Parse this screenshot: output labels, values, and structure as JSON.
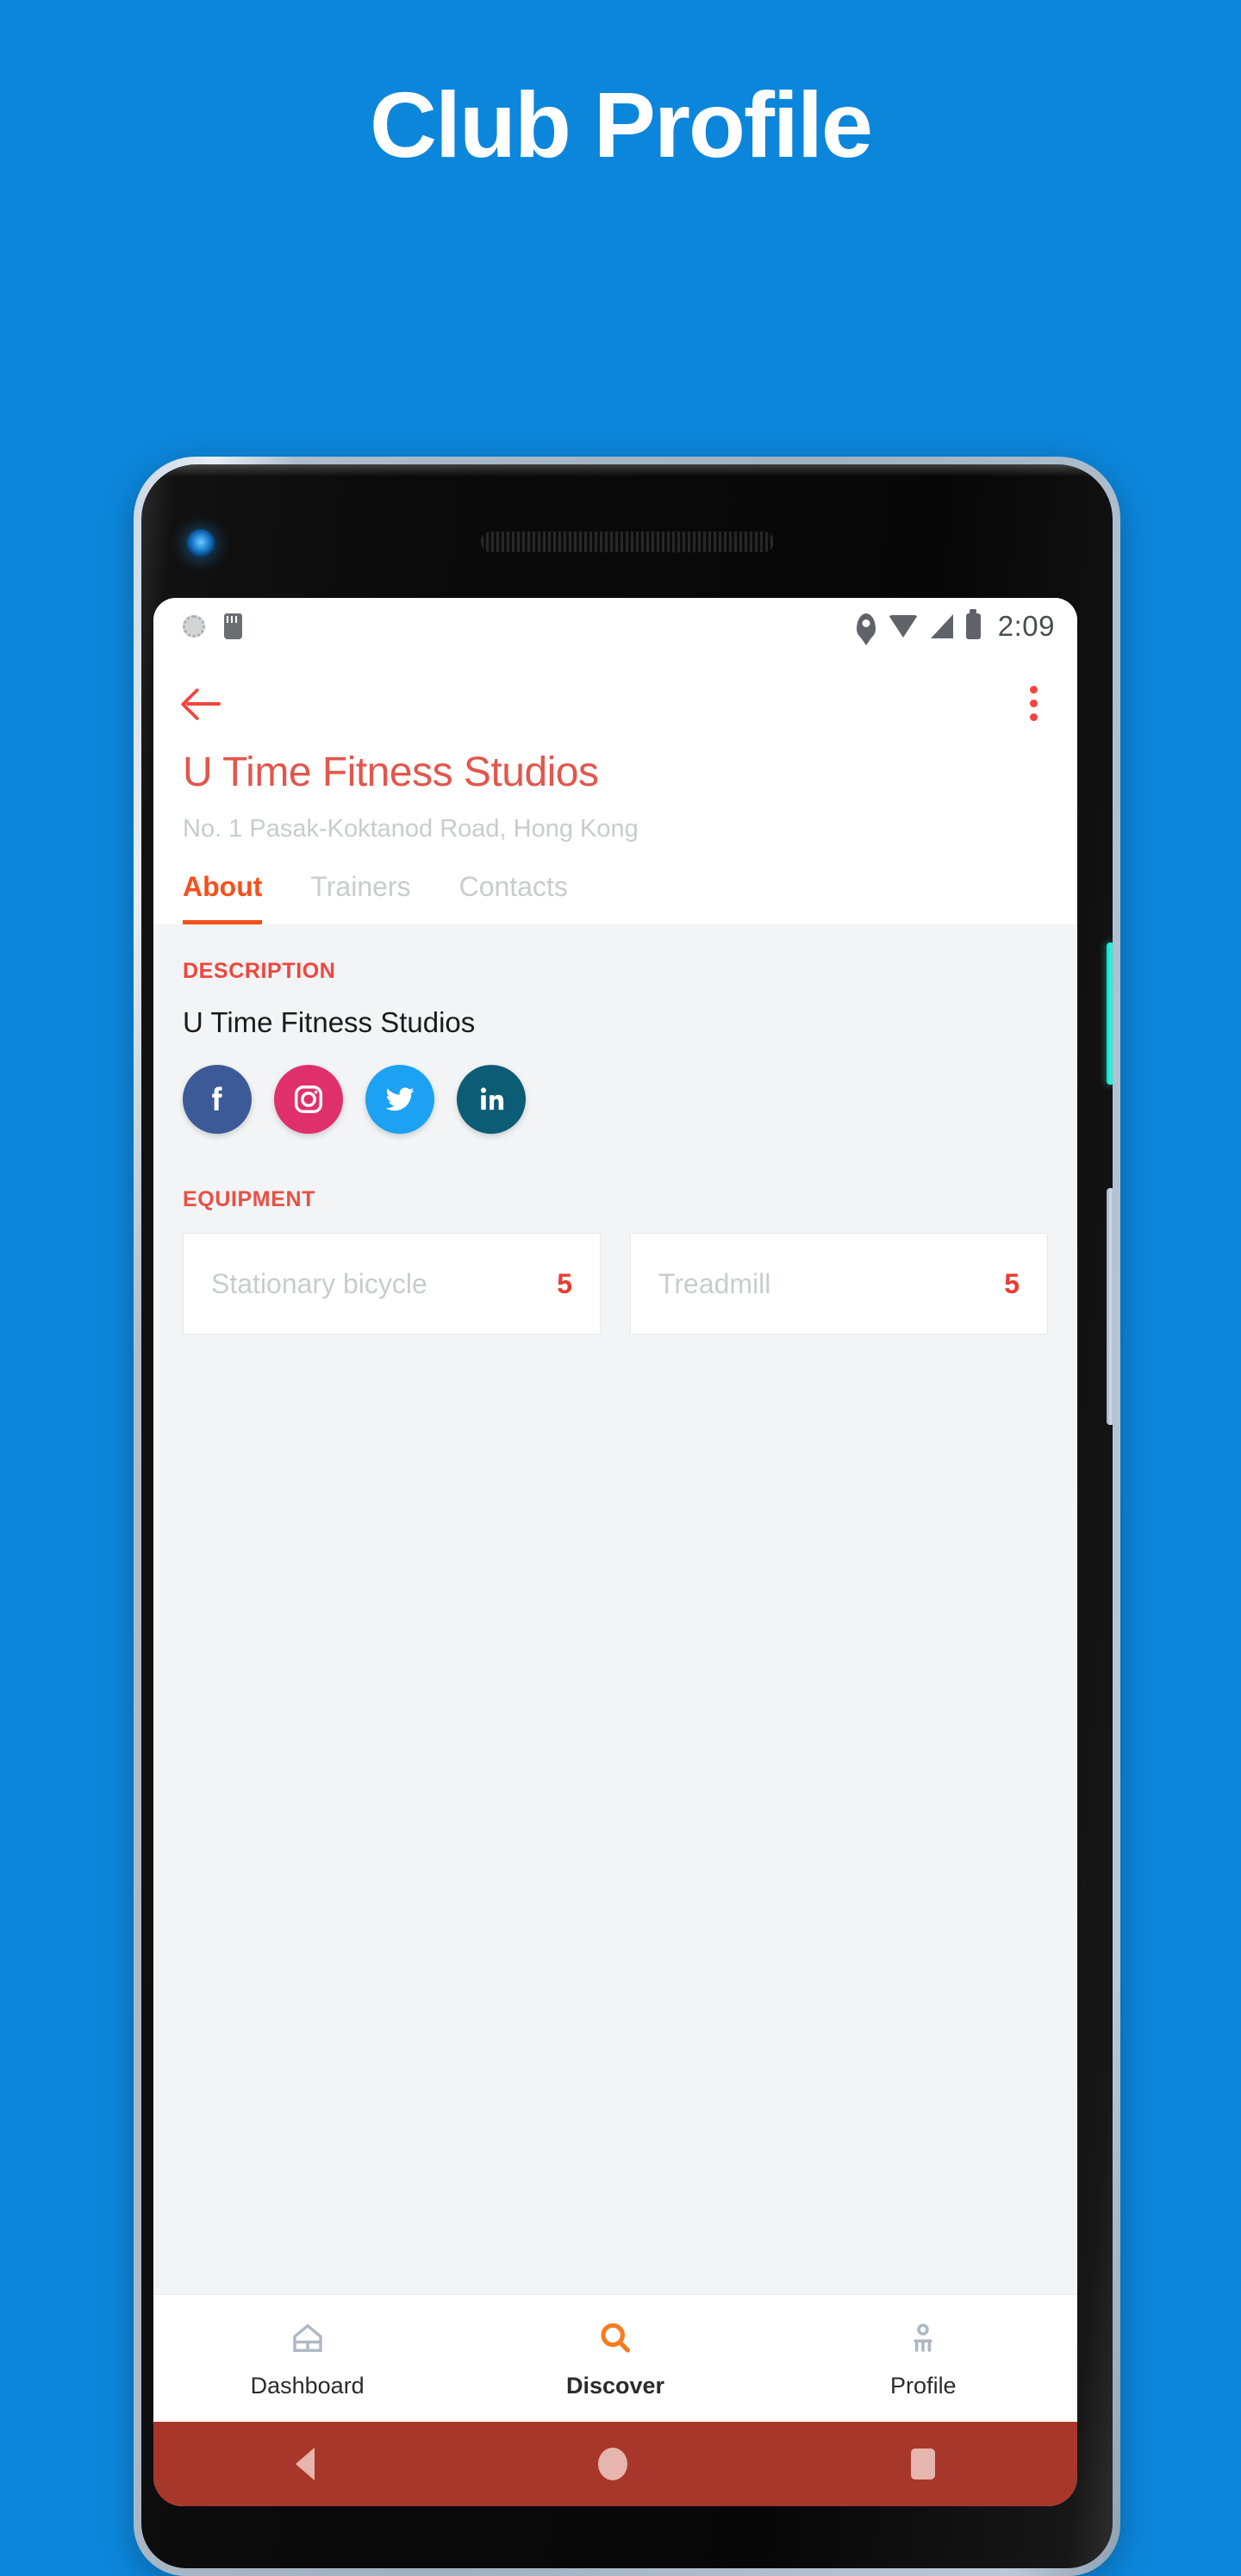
{
  "promo": {
    "title": "Club Profile",
    "background_color": "#0c86db"
  },
  "statusbar": {
    "time": "2:09",
    "left_icons": [
      "rotation-icon",
      "sd-card-icon"
    ],
    "right_icons": [
      "location-pin-icon",
      "wifi-icon",
      "signal-icon",
      "battery-icon"
    ]
  },
  "appbar": {
    "back_icon": "back-arrow-icon",
    "overflow_icon": "overflow-menu-icon",
    "club_name": "U Time Fitness Studios",
    "club_address": "No. 1 Pasak-Koktanod Road, Hong Kong",
    "accent_color": "#f4511e",
    "title_color": "#e1574c"
  },
  "tabs": [
    {
      "label": "About",
      "active": true
    },
    {
      "label": "Trainers",
      "active": false
    },
    {
      "label": "Contacts",
      "active": false
    }
  ],
  "description": {
    "section_label": "DESCRIPTION",
    "text": "U Time Fitness Studios"
  },
  "socials": [
    {
      "name": "facebook",
      "icon": "facebook-icon",
      "color": "#3d5a98"
    },
    {
      "name": "instagram",
      "icon": "instagram-icon",
      "color": "#e0306b"
    },
    {
      "name": "twitter",
      "icon": "twitter-icon",
      "color": "#1da1f2"
    },
    {
      "name": "linkedin",
      "icon": "linkedin-icon",
      "color": "#0c5c75"
    }
  ],
  "equipment": {
    "section_label": "EQUIPMENT",
    "items": [
      {
        "name": "Stationary bicycle",
        "count": "5"
      },
      {
        "name": "Treadmill",
        "count": "5"
      }
    ]
  },
  "bottomnav": [
    {
      "label": "Dashboard",
      "icon": "home-icon",
      "active": false
    },
    {
      "label": "Discover",
      "icon": "search-icon",
      "active": true
    },
    {
      "label": "Profile",
      "icon": "person-icon",
      "active": false
    }
  ],
  "sysnav": {
    "background_color": "#a8372b",
    "buttons": [
      "back-triangle-icon",
      "home-circle-icon",
      "recents-square-icon"
    ]
  }
}
